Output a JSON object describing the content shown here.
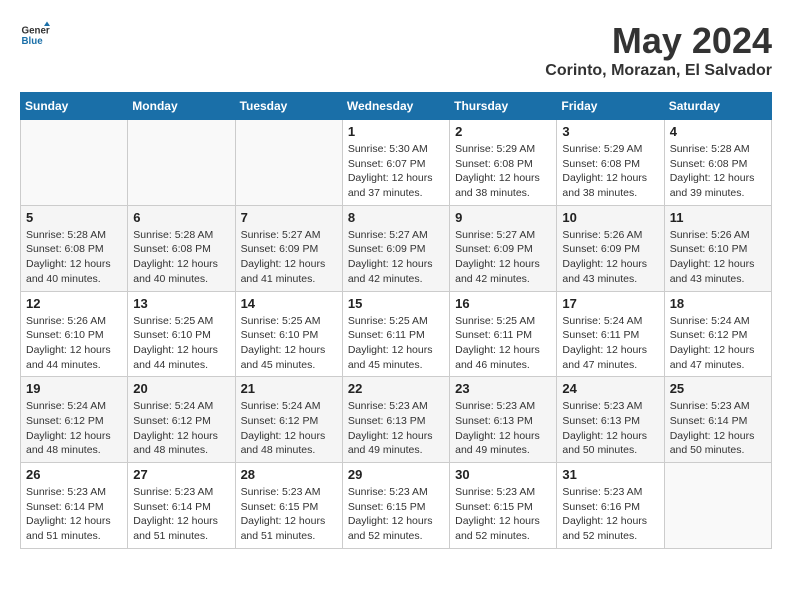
{
  "logo": {
    "general": "General",
    "blue": "Blue"
  },
  "title": "May 2024",
  "subtitle": "Corinto, Morazan, El Salvador",
  "days_of_week": [
    "Sunday",
    "Monday",
    "Tuesday",
    "Wednesday",
    "Thursday",
    "Friday",
    "Saturday"
  ],
  "weeks": [
    [
      {
        "day": "",
        "info": ""
      },
      {
        "day": "",
        "info": ""
      },
      {
        "day": "",
        "info": ""
      },
      {
        "day": "1",
        "info": "Sunrise: 5:30 AM\nSunset: 6:07 PM\nDaylight: 12 hours\nand 37 minutes."
      },
      {
        "day": "2",
        "info": "Sunrise: 5:29 AM\nSunset: 6:08 PM\nDaylight: 12 hours\nand 38 minutes."
      },
      {
        "day": "3",
        "info": "Sunrise: 5:29 AM\nSunset: 6:08 PM\nDaylight: 12 hours\nand 38 minutes."
      },
      {
        "day": "4",
        "info": "Sunrise: 5:28 AM\nSunset: 6:08 PM\nDaylight: 12 hours\nand 39 minutes."
      }
    ],
    [
      {
        "day": "5",
        "info": "Sunrise: 5:28 AM\nSunset: 6:08 PM\nDaylight: 12 hours\nand 40 minutes."
      },
      {
        "day": "6",
        "info": "Sunrise: 5:28 AM\nSunset: 6:08 PM\nDaylight: 12 hours\nand 40 minutes."
      },
      {
        "day": "7",
        "info": "Sunrise: 5:27 AM\nSunset: 6:09 PM\nDaylight: 12 hours\nand 41 minutes."
      },
      {
        "day": "8",
        "info": "Sunrise: 5:27 AM\nSunset: 6:09 PM\nDaylight: 12 hours\nand 42 minutes."
      },
      {
        "day": "9",
        "info": "Sunrise: 5:27 AM\nSunset: 6:09 PM\nDaylight: 12 hours\nand 42 minutes."
      },
      {
        "day": "10",
        "info": "Sunrise: 5:26 AM\nSunset: 6:09 PM\nDaylight: 12 hours\nand 43 minutes."
      },
      {
        "day": "11",
        "info": "Sunrise: 5:26 AM\nSunset: 6:10 PM\nDaylight: 12 hours\nand 43 minutes."
      }
    ],
    [
      {
        "day": "12",
        "info": "Sunrise: 5:26 AM\nSunset: 6:10 PM\nDaylight: 12 hours\nand 44 minutes."
      },
      {
        "day": "13",
        "info": "Sunrise: 5:25 AM\nSunset: 6:10 PM\nDaylight: 12 hours\nand 44 minutes."
      },
      {
        "day": "14",
        "info": "Sunrise: 5:25 AM\nSunset: 6:10 PM\nDaylight: 12 hours\nand 45 minutes."
      },
      {
        "day": "15",
        "info": "Sunrise: 5:25 AM\nSunset: 6:11 PM\nDaylight: 12 hours\nand 45 minutes."
      },
      {
        "day": "16",
        "info": "Sunrise: 5:25 AM\nSunset: 6:11 PM\nDaylight: 12 hours\nand 46 minutes."
      },
      {
        "day": "17",
        "info": "Sunrise: 5:24 AM\nSunset: 6:11 PM\nDaylight: 12 hours\nand 47 minutes."
      },
      {
        "day": "18",
        "info": "Sunrise: 5:24 AM\nSunset: 6:12 PM\nDaylight: 12 hours\nand 47 minutes."
      }
    ],
    [
      {
        "day": "19",
        "info": "Sunrise: 5:24 AM\nSunset: 6:12 PM\nDaylight: 12 hours\nand 48 minutes."
      },
      {
        "day": "20",
        "info": "Sunrise: 5:24 AM\nSunset: 6:12 PM\nDaylight: 12 hours\nand 48 minutes."
      },
      {
        "day": "21",
        "info": "Sunrise: 5:24 AM\nSunset: 6:12 PM\nDaylight: 12 hours\nand 48 minutes."
      },
      {
        "day": "22",
        "info": "Sunrise: 5:23 AM\nSunset: 6:13 PM\nDaylight: 12 hours\nand 49 minutes."
      },
      {
        "day": "23",
        "info": "Sunrise: 5:23 AM\nSunset: 6:13 PM\nDaylight: 12 hours\nand 49 minutes."
      },
      {
        "day": "24",
        "info": "Sunrise: 5:23 AM\nSunset: 6:13 PM\nDaylight: 12 hours\nand 50 minutes."
      },
      {
        "day": "25",
        "info": "Sunrise: 5:23 AM\nSunset: 6:14 PM\nDaylight: 12 hours\nand 50 minutes."
      }
    ],
    [
      {
        "day": "26",
        "info": "Sunrise: 5:23 AM\nSunset: 6:14 PM\nDaylight: 12 hours\nand 51 minutes."
      },
      {
        "day": "27",
        "info": "Sunrise: 5:23 AM\nSunset: 6:14 PM\nDaylight: 12 hours\nand 51 minutes."
      },
      {
        "day": "28",
        "info": "Sunrise: 5:23 AM\nSunset: 6:15 PM\nDaylight: 12 hours\nand 51 minutes."
      },
      {
        "day": "29",
        "info": "Sunrise: 5:23 AM\nSunset: 6:15 PM\nDaylight: 12 hours\nand 52 minutes."
      },
      {
        "day": "30",
        "info": "Sunrise: 5:23 AM\nSunset: 6:15 PM\nDaylight: 12 hours\nand 52 minutes."
      },
      {
        "day": "31",
        "info": "Sunrise: 5:23 AM\nSunset: 6:16 PM\nDaylight: 12 hours\nand 52 minutes."
      },
      {
        "day": "",
        "info": ""
      }
    ]
  ]
}
